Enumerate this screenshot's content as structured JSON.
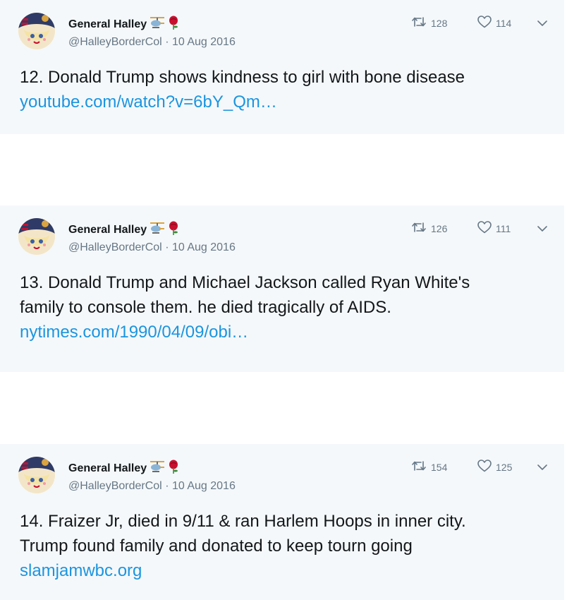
{
  "colors": {
    "card_bg": "#f5f8fa",
    "text": "#14171a",
    "muted": "#657786",
    "link": "#1b95e0"
  },
  "tweets": [
    {
      "name": "General Halley",
      "name_icons": [
        "helicopter-emoji",
        "rose-emoji"
      ],
      "handle": "@HalleyBorderCol",
      "separator": "·",
      "date": "10 Aug 2016",
      "retweets": "128",
      "likes": "114",
      "lines": [
        "12. Donald Trump shows kindness to girl with bone disease"
      ],
      "link": "youtube.com/watch?v=6bY_Qm…"
    },
    {
      "name": "General Halley",
      "name_icons": [
        "helicopter-emoji",
        "rose-emoji"
      ],
      "handle": "@HalleyBorderCol",
      "separator": "·",
      "date": "10 Aug 2016",
      "retweets": "126",
      "likes": "111",
      "lines": [
        "13. Donald Trump and Michael Jackson called Ryan White's",
        "family to console them. he died tragically of AIDS."
      ],
      "link": "nytimes.com/1990/04/09/obi…"
    },
    {
      "name": "General Halley",
      "name_icons": [
        "helicopter-emoji",
        "rose-emoji"
      ],
      "handle": "@HalleyBorderCol",
      "separator": "·",
      "date": "10 Aug 2016",
      "retweets": "154",
      "likes": "125",
      "lines": [
        "14. Fraizer Jr, died in 9/11 & ran Harlem Hoops in inner city.",
        "Trump found family and donated to keep tourn going"
      ],
      "link": "slamjamwbc.org"
    }
  ]
}
